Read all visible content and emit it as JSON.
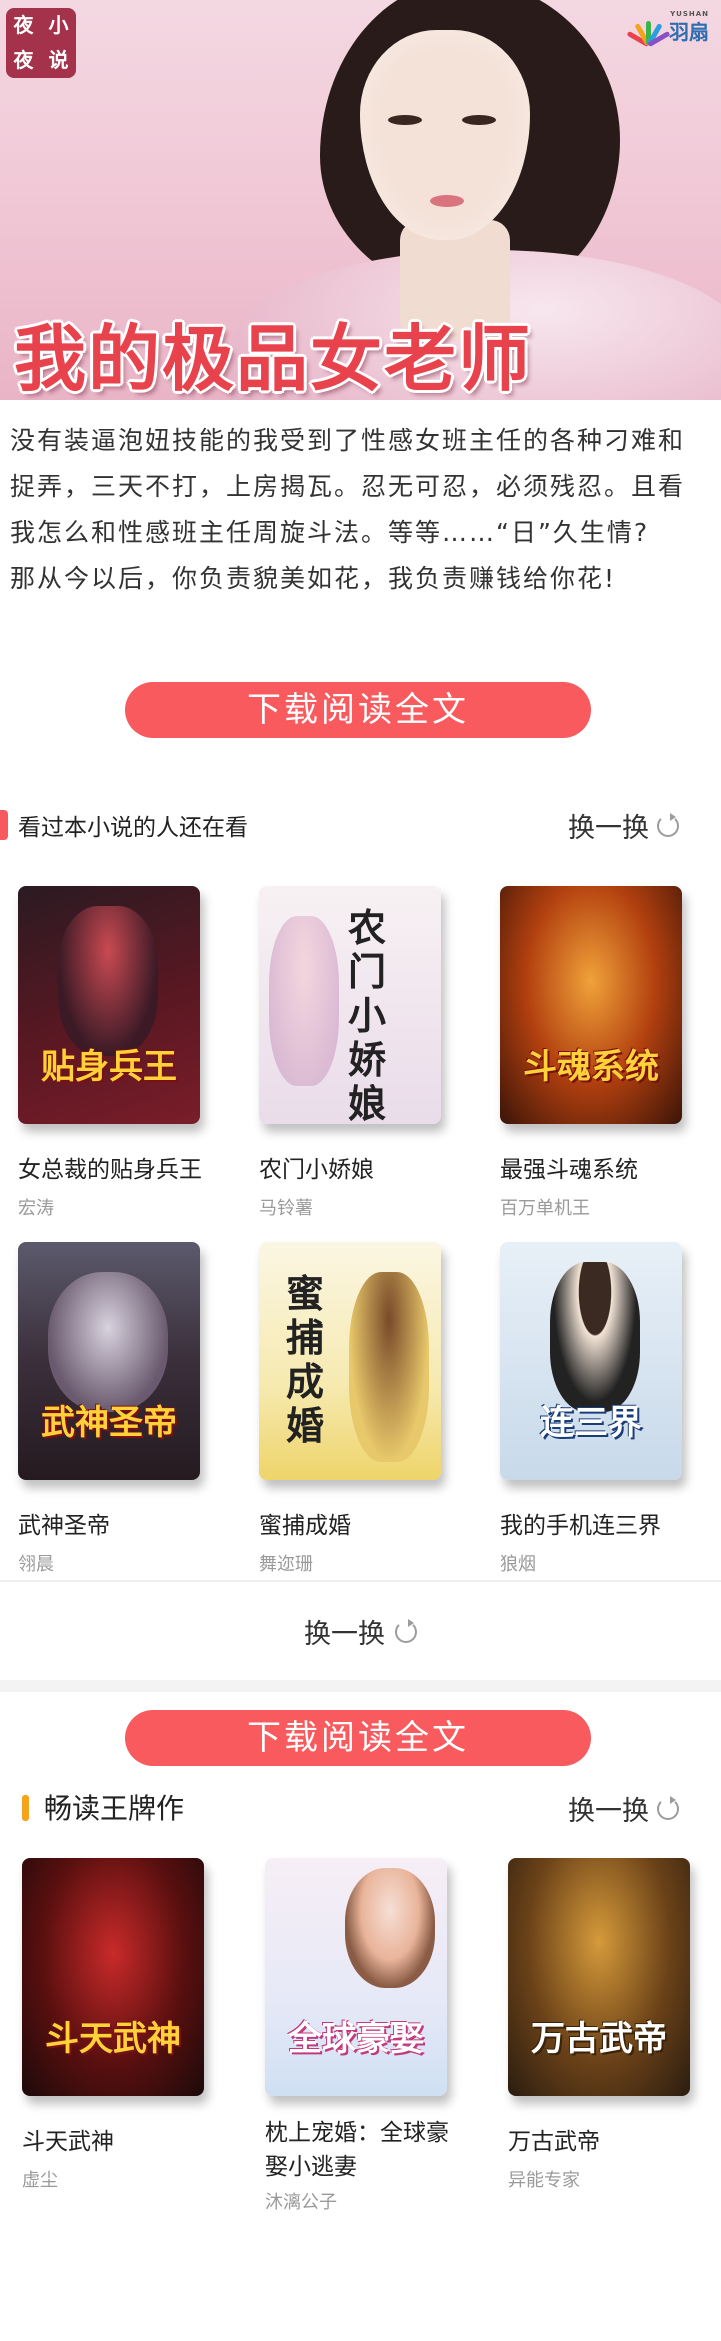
{
  "banner": {
    "title": "我的极品女老师",
    "logo_left_chars": [
      "夜",
      "小",
      "夜",
      "说"
    ],
    "brand": "羽扇",
    "brand_sub": "YUSHAN"
  },
  "intro": [
    "没有装逼泡妞技能的我受到了性感女班主任的各种刁难和捉弄，三天不打，上房揭瓦。忍无可忍，必须残忍。且看我怎么和性感班主任周旋斗法。等等……“日”久生情?",
    "那从今以后，你负责貌美如花，我负责赚钱给你花!"
  ],
  "cta_label": "下载阅读全文",
  "section1": {
    "title": "看过本小说的人还在看",
    "refresh_label": "换一换",
    "books": [
      {
        "name": "女总裁的贴身兵王",
        "author": "宏涛",
        "cover_text": "贴身兵王",
        "colors": [
          "#2b1a22",
          "#7a1d2a"
        ]
      },
      {
        "name": "农门小娇娘",
        "author": "马铃薯",
        "cover_text": "农门小娇娘",
        "colors": [
          "#f7f1f3",
          "#e9d8e6"
        ]
      },
      {
        "name": "最强斗魂系统",
        "author": "百万单机王",
        "cover_text": "斗魂系统",
        "colors": [
          "#3b1408",
          "#c24a13"
        ]
      },
      {
        "name": "武神圣帝",
        "author": "翎晨",
        "cover_text": "武神圣帝",
        "colors": [
          "#2a2130",
          "#6b5a6f"
        ]
      },
      {
        "name": "蜜捕成婚",
        "author": "舞迩珊",
        "cover_text": "蜜捕成婚",
        "colors": [
          "#fbf6e3",
          "#f2e08a"
        ]
      },
      {
        "name": "我的手机连三界",
        "author": "狼烟",
        "cover_text": "连三界",
        "colors": [
          "#e8f0f7",
          "#3a6db5"
        ]
      }
    ],
    "bottom_refresh_label": "换一换"
  },
  "section2": {
    "title": "畅读王牌作",
    "refresh_label": "换一换",
    "books": [
      {
        "name": "斗天武神",
        "author": "虚尘",
        "cover_text": "斗天武神",
        "colors": [
          "#1c0a0a",
          "#b21d1d"
        ]
      },
      {
        "name": "枕上宠婚：全球豪娶小逃妻",
        "author": "沐漓公子",
        "cover_text": "全球豪娶",
        "colors": [
          "#f7eef6",
          "#cfe0f3"
        ]
      },
      {
        "name": "万古武帝",
        "author": "异能专家",
        "cover_text": "万古武帝",
        "colors": [
          "#2a1c10",
          "#9a6b23"
        ]
      }
    ]
  }
}
